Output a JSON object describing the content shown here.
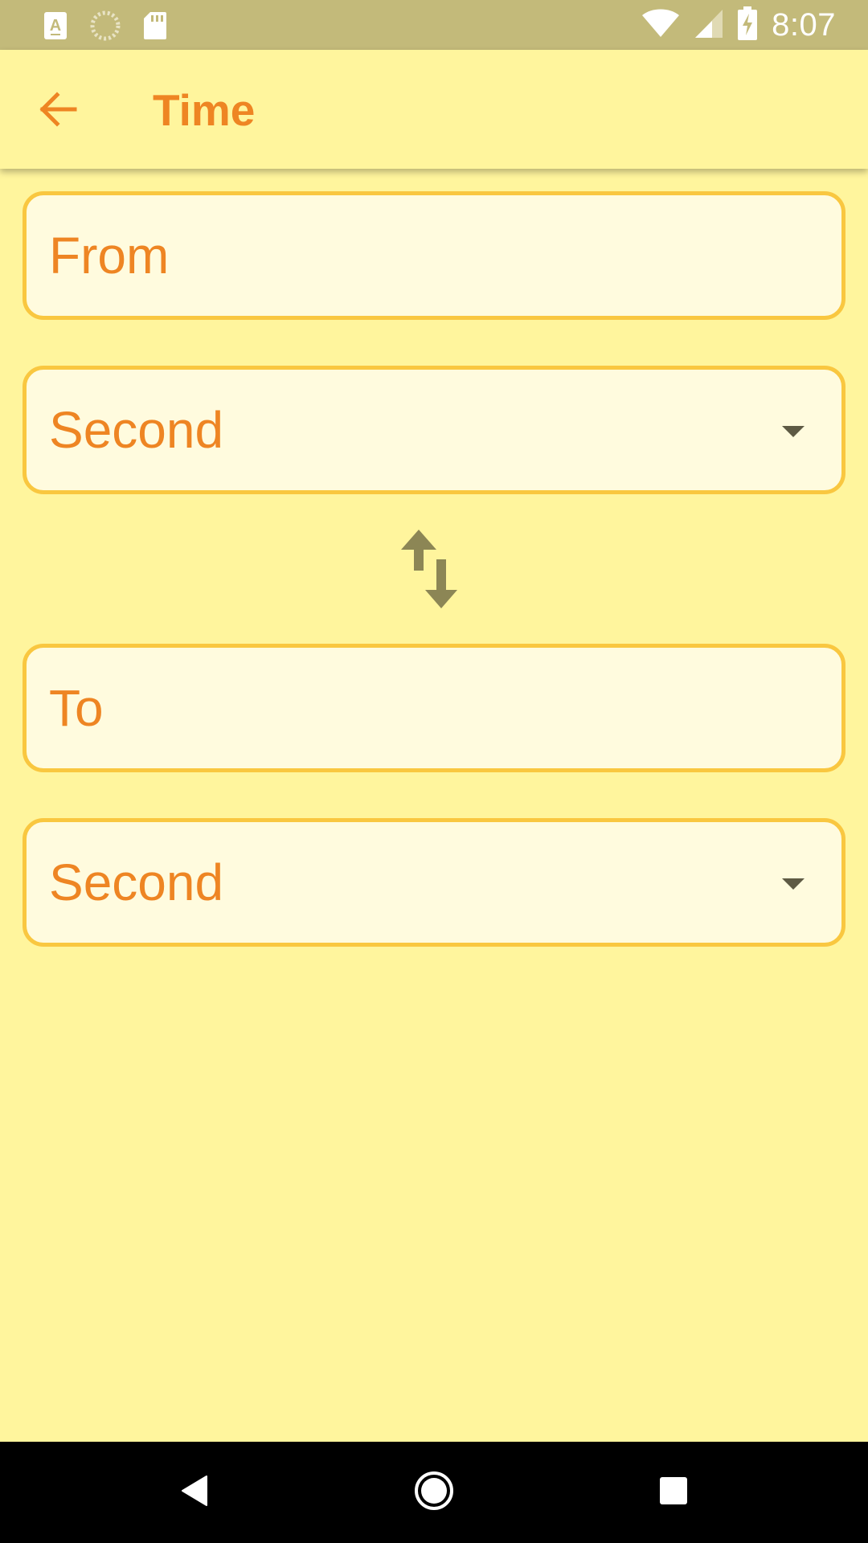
{
  "status_bar": {
    "time": "8:07",
    "left_icons": [
      "keyboard-a-icon",
      "loading-spinner-icon",
      "sd-card-icon"
    ],
    "right_icons": [
      "wifi-icon",
      "cell-signal-icon",
      "battery-charging-icon"
    ]
  },
  "app_bar": {
    "title": "Time",
    "back_icon": "arrow-back-icon"
  },
  "converter": {
    "from_placeholder": "From",
    "from_unit": "Second",
    "swap_icon": "swap-vert-icon",
    "to_placeholder": "To",
    "to_unit": "Second"
  },
  "nav_bar": {
    "back_icon": "nav-back-icon",
    "home_icon": "nav-home-icon",
    "recents_icon": "nav-recents-icon"
  },
  "colors": {
    "background": "#FFF59D",
    "status_bar": "#C3BA7A",
    "accent_text": "#EE8523",
    "field_border": "#F9C740",
    "field_fill": "#FFFBDE",
    "icon_dark": "#8C8655"
  }
}
